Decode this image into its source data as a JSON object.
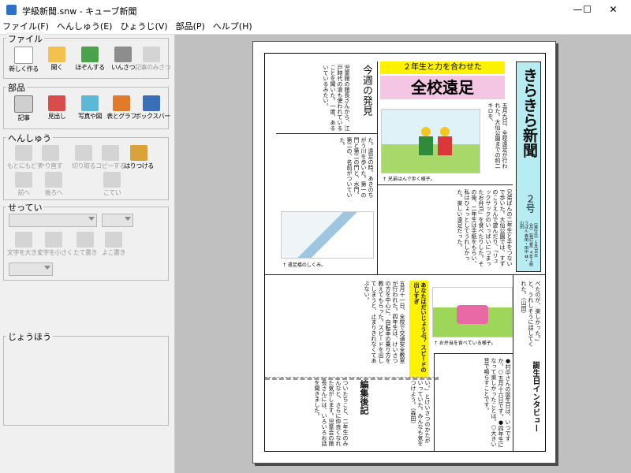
{
  "window": {
    "title": "学級新聞.snw - キューブ新聞",
    "minimize_glyph": "—",
    "maximize_glyph": "☐",
    "close_glyph": "✕"
  },
  "menu": [
    "ファイル(F)",
    "へんしゅう(E)",
    "ひょうじ(V)",
    "部品(P)",
    "ヘルプ(H)"
  ],
  "panels": {
    "file": {
      "label": "ファイル",
      "tools": [
        {
          "label": "新しく作る",
          "icon": "new-page-icon",
          "enabled": true
        },
        {
          "label": "開く",
          "icon": "open-folder-icon",
          "enabled": true
        },
        {
          "label": "ほぞんする",
          "icon": "save-icon",
          "enabled": true
        },
        {
          "label": "いんさつ",
          "icon": "printer-icon",
          "enabled": true
        },
        {
          "label": "記事のみさつ",
          "icon": "print-article-icon",
          "enabled": false
        }
      ]
    },
    "parts": {
      "label": "部品",
      "tools": [
        {
          "label": "記事",
          "icon": "article-icon",
          "enabled": true
        },
        {
          "label": "見出し",
          "icon": "headline-icon",
          "enabled": true
        },
        {
          "label": "写真や図",
          "icon": "photo-icon",
          "enabled": true
        },
        {
          "label": "表とグラフ",
          "icon": "chart-icon",
          "enabled": true
        },
        {
          "label": "ボックスバー",
          "icon": "boxbar-icon",
          "enabled": true
        }
      ]
    },
    "edit": {
      "label": "へんしゅう",
      "tools": [
        {
          "label": "もとにもどす",
          "icon": "undo-icon",
          "enabled": false
        },
        {
          "label": "やり直す",
          "icon": "redo-icon",
          "enabled": false
        },
        {
          "label": "切り取る",
          "icon": "cut-icon",
          "enabled": false
        },
        {
          "label": "コピーする",
          "icon": "copy-icon",
          "enabled": false
        },
        {
          "label": "はりつける",
          "icon": "paste-icon",
          "enabled": true
        },
        {
          "label": "前へ",
          "icon": "bring-forward-icon",
          "enabled": false
        },
        {
          "label": "後ろへ",
          "icon": "send-backward-icon",
          "enabled": false
        },
        {
          "label": "こてい",
          "icon": "pin-icon",
          "enabled": false
        }
      ]
    },
    "settings": {
      "label": "せってい",
      "tools": [
        {
          "label": "文字を大きく",
          "icon": "font-larger-icon",
          "enabled": false
        },
        {
          "label": "文字を小さく",
          "icon": "font-smaller-icon",
          "enabled": false
        },
        {
          "label": "たて書き",
          "icon": "vertical-writing-icon",
          "enabled": false
        },
        {
          "label": "よこ書き",
          "icon": "horizontal-writing-icon",
          "enabled": false
        }
      ]
    },
    "info": {
      "label": "じょうほう"
    }
  },
  "newspaper": {
    "title": "きらきら新聞",
    "issue": "２号",
    "pubinfo": "［発行日］５月16日（月）［発行者］４年１組うぱん 森田・田中 林・山田",
    "headline_sub": "２年生と力を合わせた",
    "headline_main": "全校遠足",
    "article1": "五月九日、全校遠足が行われた。大仙公園までの約二キロを、",
    "article1_body": "兄弟ぱんの二年生と手をつないで歩いた。大仙公園では、すずのこうえんで遊んだり、「リュックサックのいっぱいにつまったお弁当」を食べたりした。その後、二年生は手紙をもらい、私はひょっとしてうれしかった。楽しい遠足だった。",
    "photo1_caption": "↑ 兄弟はんで歩く様子。",
    "weekly_title": "今週の発見",
    "weekly_text": "児童館の館長さんから、江戸時代の道も使われていることを聞いた。一度、あるいているみたい。",
    "weekly_text2": "た。遠足の時、あきのちがう川を歩いた。第一の門と第二の門と、水門、第二の、名前がついていた。",
    "photo2_caption": "↑ 遠足橋のしくみ。",
    "speed_title": "あなたはだいじょうぶ？ スピードの出しすぎ",
    "speed_text": "五月十一日、全校で交通安全教室が行われた。四年生は、けいさつの方を中心に、自転車の乗り方を教えてもらった。スピードを出してしまうと、止まりきれなくてあぶない。",
    "photo3_caption": "↑ お弁当を食べている様子。",
    "editor_title": "編集後記",
    "editor_text": "ついたちこと、二年生のみんなと、さらに仲良くなれた気がします。児童会の館長さんには、いろいろお話を聞きました。",
    "interview_title": "誕生日インタビュー",
    "interview_text": "●村中さんの誕生日は、いつですか。○五月十六日です。●四年生になって楽しかったことは。○大きい音で鳴らすことです。",
    "misc_text": "べたのが、楽しかった。」と、うれしそうに話してくれた。（山田）",
    "misc2": "い。」とけいさつのかたがいっていた。みんなも気をつけよう。（森田）"
  }
}
